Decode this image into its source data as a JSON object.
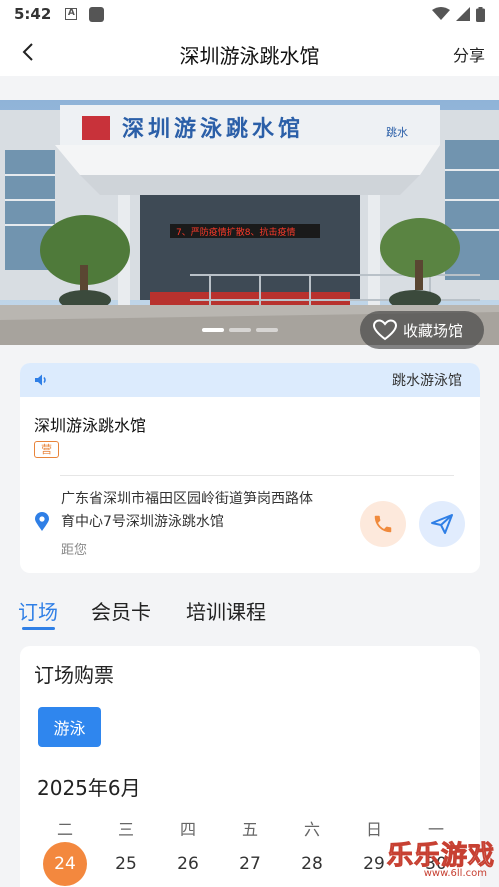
{
  "status_bar": {
    "time": "5:42",
    "a_icon": "A"
  },
  "header": {
    "title": "深圳游泳跳水馆",
    "share_label": "分享"
  },
  "hero": {
    "sign_text": "深圳游泳跳水馆",
    "sign_suffix": "跳水",
    "led_text": "7、严防疫情扩散8、抗击疫情",
    "favorite_label": "收藏场馆",
    "slide_count": 3,
    "active_slide": 1
  },
  "info": {
    "notice_text": "跳水游泳馆",
    "venue_name": "深圳游泳跳水馆",
    "tag": "营",
    "address": "广东省深圳市福田区园岭街道笋岗西路体育中心7号深圳游泳跳水馆",
    "distance_label": "距您"
  },
  "tabs": [
    {
      "label": "订场",
      "active": true
    },
    {
      "label": "会员卡",
      "active": false
    },
    {
      "label": "培训课程",
      "active": false
    }
  ],
  "booking": {
    "title": "订场购票",
    "sport": "游泳",
    "month": "2025年6月",
    "weekdays": [
      "二",
      "三",
      "四",
      "五",
      "六",
      "日",
      "一"
    ],
    "days": [
      "24",
      "25",
      "26",
      "27",
      "28",
      "29",
      "30"
    ],
    "selected_day": "24"
  },
  "watermark": {
    "text": "乐乐游戏",
    "url": "www.6ll.com"
  },
  "colors": {
    "accent": "#2f7fe6",
    "selected_day": "#f3883e",
    "notice_bg": "#dcebfd"
  }
}
